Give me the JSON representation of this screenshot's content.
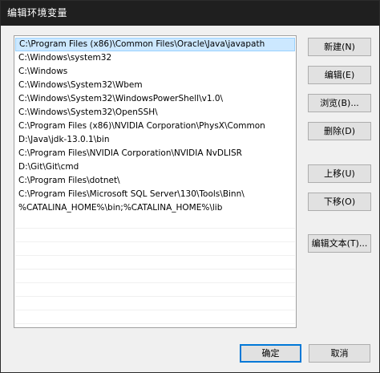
{
  "window": {
    "title": "编辑环境变量"
  },
  "path_list": {
    "items": [
      "C:\\Program Files (x86)\\Common Files\\Oracle\\Java\\javapath",
      "C:\\Windows\\system32",
      "C:\\Windows",
      "C:\\Windows\\System32\\Wbem",
      "C:\\Windows\\System32\\WindowsPowerShell\\v1.0\\",
      "C:\\Windows\\System32\\OpenSSH\\",
      "C:\\Program Files (x86)\\NVIDIA Corporation\\PhysX\\Common",
      "D:\\Java\\jdk-13.0.1\\bin",
      "C:\\Program Files\\NVIDIA Corporation\\NVIDIA NvDLISR",
      "D:\\Git\\Git\\cmd",
      "C:\\Program Files\\dotnet\\",
      "C:\\Program Files\\Microsoft SQL Server\\130\\Tools\\Binn\\",
      "%CATALINA_HOME%\\bin;%CATALINA_HOME%\\lib"
    ],
    "selected_index": 0
  },
  "buttons": {
    "new_label": "新建(N)",
    "edit_label": "编辑(E)",
    "browse_label": "浏览(B)...",
    "delete_label": "删除(D)",
    "move_up_label": "上移(U)",
    "move_down_label": "下移(O)",
    "edit_text_label": "编辑文本(T)...",
    "ok_label": "确定",
    "cancel_label": "取消"
  },
  "colors": {
    "titlebar": "#1f1f1f",
    "selection_fill": "#cce8ff",
    "selection_border": "#99d1ff",
    "focus_border": "#0078d7"
  }
}
